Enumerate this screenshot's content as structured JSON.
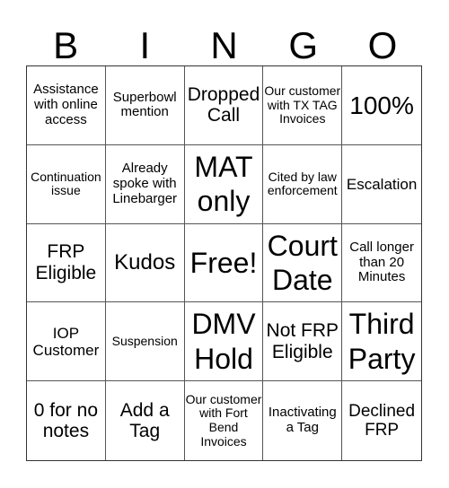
{
  "header": {
    "letters": [
      "B",
      "I",
      "N",
      "G",
      "O"
    ]
  },
  "cells": [
    "Assistance with online access",
    "Superbowl mention",
    "Dropped Call",
    "Our customer with TX TAG Invoices",
    "100%",
    "Continuation issue",
    "Already spoke with Linebarger",
    "MAT only",
    "Cited by law enforcement",
    "Escalation",
    "FRP Eligible",
    "Kudos",
    "Free!",
    "Court Date",
    "Call longer than 20 Minutes",
    "IOP Customer",
    "Suspension",
    "DMV Hold",
    "Not FRP Eligible",
    "Third Party",
    "0 for no notes",
    "Add a Tag",
    "Our customer with Fort Bend Invoices",
    "Inactivating a Tag",
    "Declined FRP"
  ]
}
